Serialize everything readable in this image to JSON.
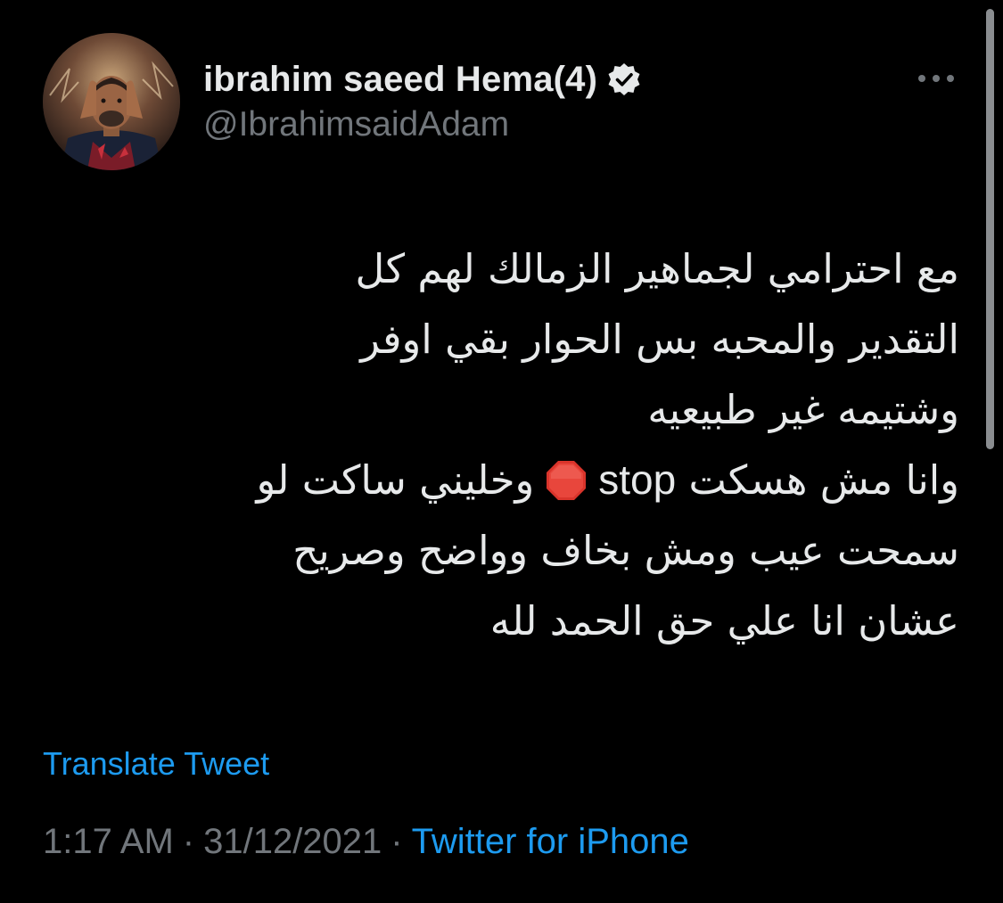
{
  "colors": {
    "background": "#000000",
    "primary_text": "#e7e9ea",
    "secondary_text": "#71767b",
    "link": "#1d9bf0"
  },
  "author": {
    "display_name": "ibrahim saeed Hema(4)",
    "handle": "@IbrahimsaidAdam",
    "verified_icon": "verified-badge-icon",
    "avatar_icon": "profile-photo"
  },
  "more_menu": {
    "icon": "more-horizontal-icon"
  },
  "tweet": {
    "lines": [
      "مع احترامي لجماهير الزمالك لهم كل",
      "التقدير والمحبه بس الحوار بقي اوفر",
      "وشتيمه غير طبيعيه",
      "وانا مش هسكت",
      "سمحت عيب ومش بخاف وواضح وصريح",
      "عشان انا علي حق الحمد لله"
    ],
    "line4_stop_word": "stop",
    "stop_emoji_icon": "stop-sign-emoji",
    "line4_after": "وخليني ساكت لو"
  },
  "translate_label": "Translate Tweet",
  "meta": {
    "time": "1:17 AM",
    "separator": "·",
    "date": "31/12/2021",
    "source": "Twitter for iPhone"
  }
}
